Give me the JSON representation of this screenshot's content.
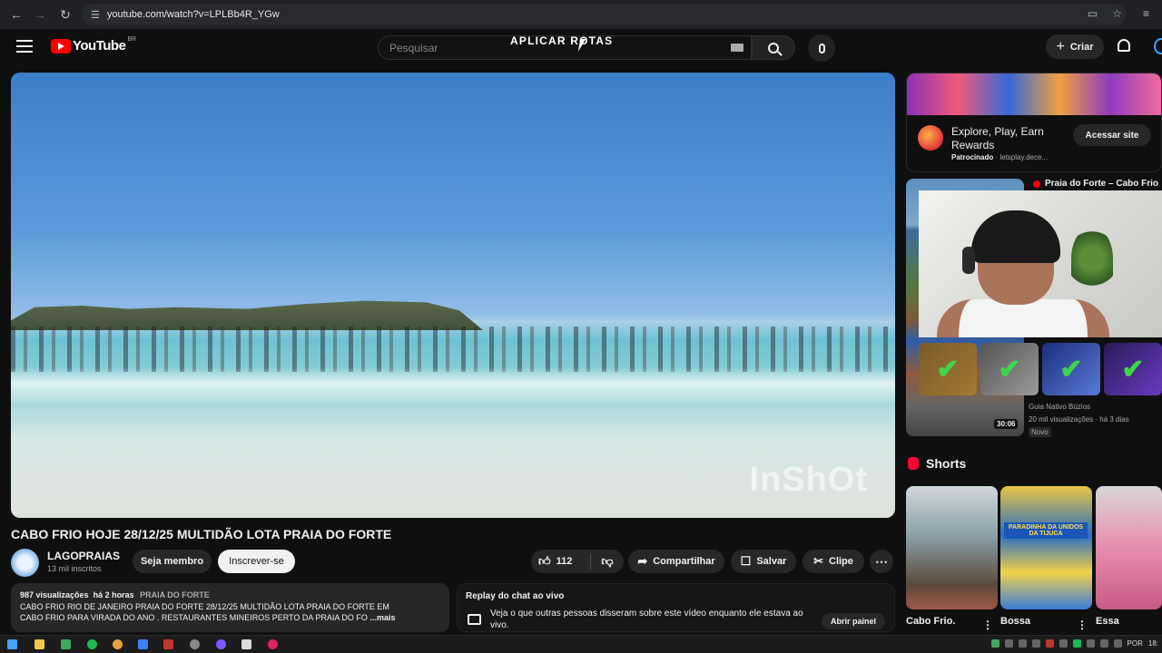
{
  "browser": {
    "url": "youtube.com/watch?v=LPLBb4R_YGw"
  },
  "header": {
    "logo_text": "YouTube",
    "region": "BR",
    "search_placeholder": "Pesquisar",
    "overlay_title": "APLICAR ROTAS",
    "create_label": "Criar"
  },
  "video": {
    "watermark": "InShOt",
    "title": "CABO FRIO HOJE 28/12/25 MULTIDÃO LOTA PRAIA DO FORTE",
    "channel_name": "LAGOPRAIAS",
    "subscribers": "13 mil inscritos",
    "member_label": "Seja membro",
    "subscribe_label": "Inscrever-se",
    "likes": "112",
    "share_label": "Compartilhar",
    "save_label": "Salvar",
    "clip_label": "Clipe"
  },
  "description": {
    "views": "987 visualizações",
    "age": "há 2 horas",
    "tag": "PRAIA DO FORTE",
    "line1": "CABO FRIO RIO DE JANEIRO PRAIA DO FORTE 28/12/25 MULTIDÃO LOTA PRAIA DO FORTE EM",
    "line2": "CABO FRIO PARA VIRADA DO ANO . RESTAURANTES MINEIROS PERTO DA PRAIA DO FO",
    "more": "...mais"
  },
  "chat_replay": {
    "title": "Replay do chat ao vivo",
    "text": "Veja o que outras pessoas disseram sobre este vídeo enquanto ele estava ao vivo.",
    "button": "Abrir painel"
  },
  "ad": {
    "title": "Explore, Play, Earn Rewards",
    "sponsored": "Patrocinado",
    "domain": "letsplay.dece...",
    "cta": "Acessar site"
  },
  "recommendation": {
    "title": "Praia do Forte – Cabo Frio",
    "channel": "Guia Nativo Búzios",
    "views": "20 mil visualizações",
    "age": "há 3 dias",
    "badge": "Novo",
    "duration": "30:06"
  },
  "shorts": {
    "heading": "Shorts",
    "items": [
      {
        "label": "Cabo Frio."
      },
      {
        "label": "Bossa"
      },
      {
        "label": "Essa"
      }
    ],
    "tag": "PARADINHA DA UNIDOS DA TIJUCA"
  },
  "taskbar": {
    "lang": "POR",
    "time": "18:"
  },
  "colors": {
    "brand_red": "#ff0000",
    "background": "#0f0f0f",
    "pill": "#272727",
    "check_green": "#41d64a"
  }
}
